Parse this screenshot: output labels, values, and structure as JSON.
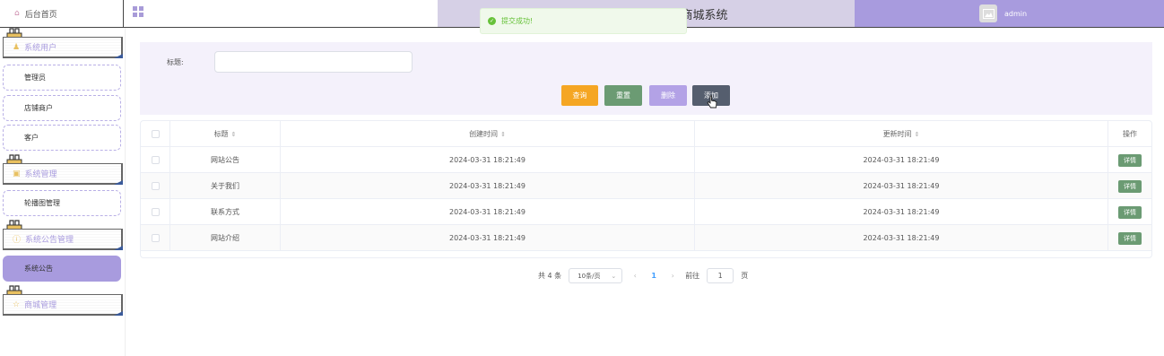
{
  "header": {
    "home_label": "后台首页",
    "title": "欢迎使用在线天旅商品商城系统",
    "username": "admin"
  },
  "toast": {
    "message": "提交成功!"
  },
  "sidebar": {
    "groups": [
      {
        "label": "系统用户",
        "icon": "user-icon",
        "items": [
          "管理员",
          "店铺商户",
          "客户"
        ]
      },
      {
        "label": "系统管理",
        "icon": "setting-icon",
        "items": [
          "轮播图管理"
        ]
      },
      {
        "label": "系统公告管理",
        "icon": "info-icon",
        "items": [
          "系统公告"
        ]
      },
      {
        "label": "商城管理",
        "icon": "cart-icon",
        "items": []
      }
    ],
    "active_item": "系统公告"
  },
  "search": {
    "title_label": "标题:",
    "title_value": "",
    "buttons": {
      "query": "查询",
      "reset": "重置",
      "delete": "删除",
      "add": "添加"
    }
  },
  "table": {
    "columns": [
      "标题",
      "创建时间",
      "更新时间",
      "操作"
    ],
    "rows": [
      {
        "title": "网站公告",
        "created": "2024-03-31 18:21:49",
        "updated": "2024-03-31 18:21:49",
        "action": "详情"
      },
      {
        "title": "关于我们",
        "created": "2024-03-31 18:21:49",
        "updated": "2024-03-31 18:21:49",
        "action": "详情"
      },
      {
        "title": "联系方式",
        "created": "2024-03-31 18:21:49",
        "updated": "2024-03-31 18:21:49",
        "action": "详情"
      },
      {
        "title": "网站介绍",
        "created": "2024-03-31 18:21:49",
        "updated": "2024-03-31 18:21:49",
        "action": "详情"
      }
    ]
  },
  "pagination": {
    "total_text": "共 4 条",
    "page_size": "10条/页",
    "current_page": "1",
    "goto_label": "前往",
    "goto_value": "1",
    "page_suffix": "页"
  },
  "colors": {
    "accent": "#a89bde",
    "title_band": "#d6d0e6",
    "query": "#f5a623",
    "reset": "#6b9b73",
    "delete": "#b3a2e6",
    "add": "#555e6e",
    "success": "#67c23a"
  }
}
